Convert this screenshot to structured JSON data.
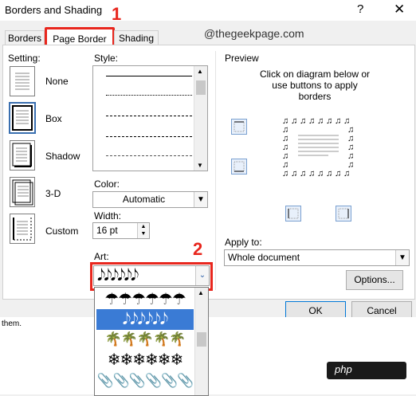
{
  "window": {
    "title": "Borders and Shading",
    "help": "?",
    "close": "✕"
  },
  "tabs": [
    {
      "label": "Borders"
    },
    {
      "label": "Page Border"
    },
    {
      "label": "Shading"
    }
  ],
  "watermark": "@thegeekpage.com",
  "setting": {
    "heading": "Setting:",
    "options": [
      {
        "label": "None"
      },
      {
        "label": "Box"
      },
      {
        "label": "Shadow"
      },
      {
        "label": "3-D"
      },
      {
        "label": "Custom"
      }
    ]
  },
  "style": {
    "heading": "Style:"
  },
  "color": {
    "label": "Color:",
    "value": "Automatic"
  },
  "width": {
    "label": "Width:",
    "value": "16 pt"
  },
  "art": {
    "label": "Art:",
    "selected": "𝅘𝅥𝅮𝅘𝅥𝅮𝅘𝅥𝅮𝅘𝅥𝅮𝅘𝅥𝅮𝅘𝅥𝅮",
    "options": [
      "☂☂☂☂☂☂",
      "𝅘𝅥𝅮𝅘𝅥𝅮𝅘𝅥𝅮𝅘𝅥𝅮𝅘𝅥𝅮𝅘𝅥𝅮",
      "🌴🌴🌴🌴🌴",
      "❄❄❄❄❄❄",
      "📎📎📎📎📎📎"
    ]
  },
  "preview": {
    "heading": "Preview",
    "instructions": "Click on diagram below or use buttons to apply borders"
  },
  "apply_to": {
    "label": "Apply to:",
    "value": "Whole document"
  },
  "buttons": {
    "options": "Options...",
    "ok": "OK",
    "cancel": "Cancel"
  },
  "annotations": {
    "step1": "1",
    "step2": "2"
  },
  "background_text": "them.",
  "badge": "php",
  "colors": {
    "accent_red": "#e8261d",
    "selection_blue": "#3a7bd5"
  }
}
